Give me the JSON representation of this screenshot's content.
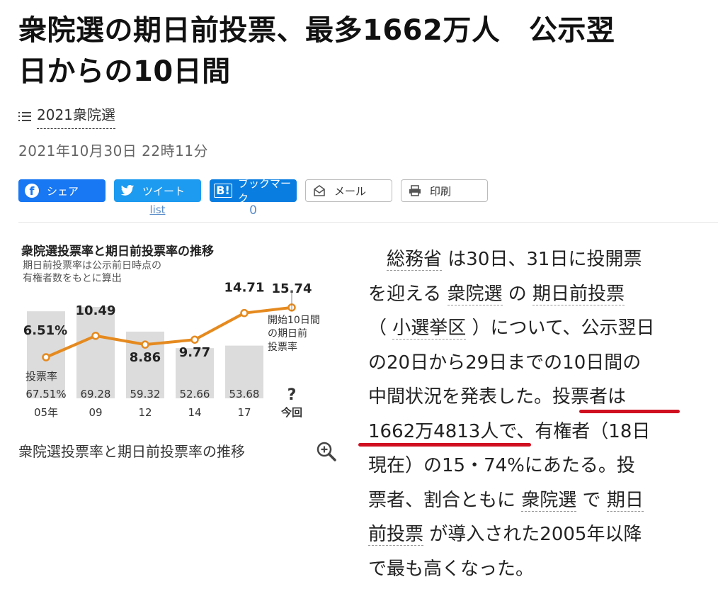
{
  "headline": {
    "line1": "衆院選の期日前投票、最多1662万人　公示翌",
    "line2": "日からの10日間"
  },
  "category": {
    "label": "2021衆院選"
  },
  "date": "2021年10月30日  22時11分",
  "share": {
    "facebook": {
      "label": "シェア",
      "icon": "facebook-icon"
    },
    "twitter": {
      "label": "ツイート",
      "icon": "twitter-icon",
      "count_label": "list"
    },
    "hatena": {
      "label": "ブックマーク",
      "icon": "hatena-bookmark-icon",
      "icon_text": "B!",
      "count": "0"
    },
    "mail": {
      "label": "メール",
      "icon": "mail-icon"
    },
    "print": {
      "label": "印刷",
      "icon": "printer-icon"
    }
  },
  "figure": {
    "title": "衆院選投票率と期日前投票率の推移",
    "note_line1": "期日前投票率は公示前日時点の",
    "note_line2": "有権者数をもとに算出",
    "turnout_label": "投票率",
    "annotation_line1": "開始10日間",
    "annotation_line2": "の期日前",
    "annotation_line3": "投票率",
    "caption": "衆院選投票率と期日前投票率の推移",
    "colors": {
      "line": "#e58a1f",
      "bar": "#dcdcdc"
    }
  },
  "chart_data": {
    "type": "bar",
    "title": "衆院選投票率と期日前投票率の推移",
    "categories": [
      "05年",
      "09",
      "12",
      "14",
      "17",
      "今回"
    ],
    "series": [
      {
        "name": "投票率",
        "type": "bar",
        "values": [
          67.51,
          69.28,
          59.32,
          52.66,
          53.68,
          null
        ],
        "labels": [
          "67.51%",
          "69.28",
          "59.32",
          "52.66",
          "53.68",
          "?"
        ]
      },
      {
        "name": "期日前投票率",
        "type": "line",
        "values": [
          6.51,
          10.49,
          8.86,
          9.77,
          14.71,
          15.74
        ],
        "labels": [
          "6.51%",
          "10.49",
          "8.86",
          "9.77",
          "14.71",
          "15.74"
        ]
      }
    ]
  },
  "body": {
    "line1_pre": "",
    "line1_kw": "総務省",
    "line1_post": " は30日、31日に投開票",
    "line2_pre": "を迎える ",
    "line2_kw1": "衆院選",
    "line2_mid": " の ",
    "line2_kw2": "期日前投票",
    "line3_pre": "（ ",
    "line3_kw": "小選挙区",
    "line3_post": " ）について、公示翌日",
    "line4": "の20日から29日までの10日間の",
    "line5": "中間状況を発表した。投票者は",
    "line6": "1662万4813人で、有権者（18日",
    "line7": "現在）の15・74%にあたる。投",
    "line8_pre": "票者、割合ともに ",
    "line8_kw1": "衆院選",
    "line8_mid": " で ",
    "line8_kw2": "期日",
    "line9_kw": "前投票",
    "line9_post": " が導入された2005年以降",
    "line10": "で最も高くなった。"
  }
}
